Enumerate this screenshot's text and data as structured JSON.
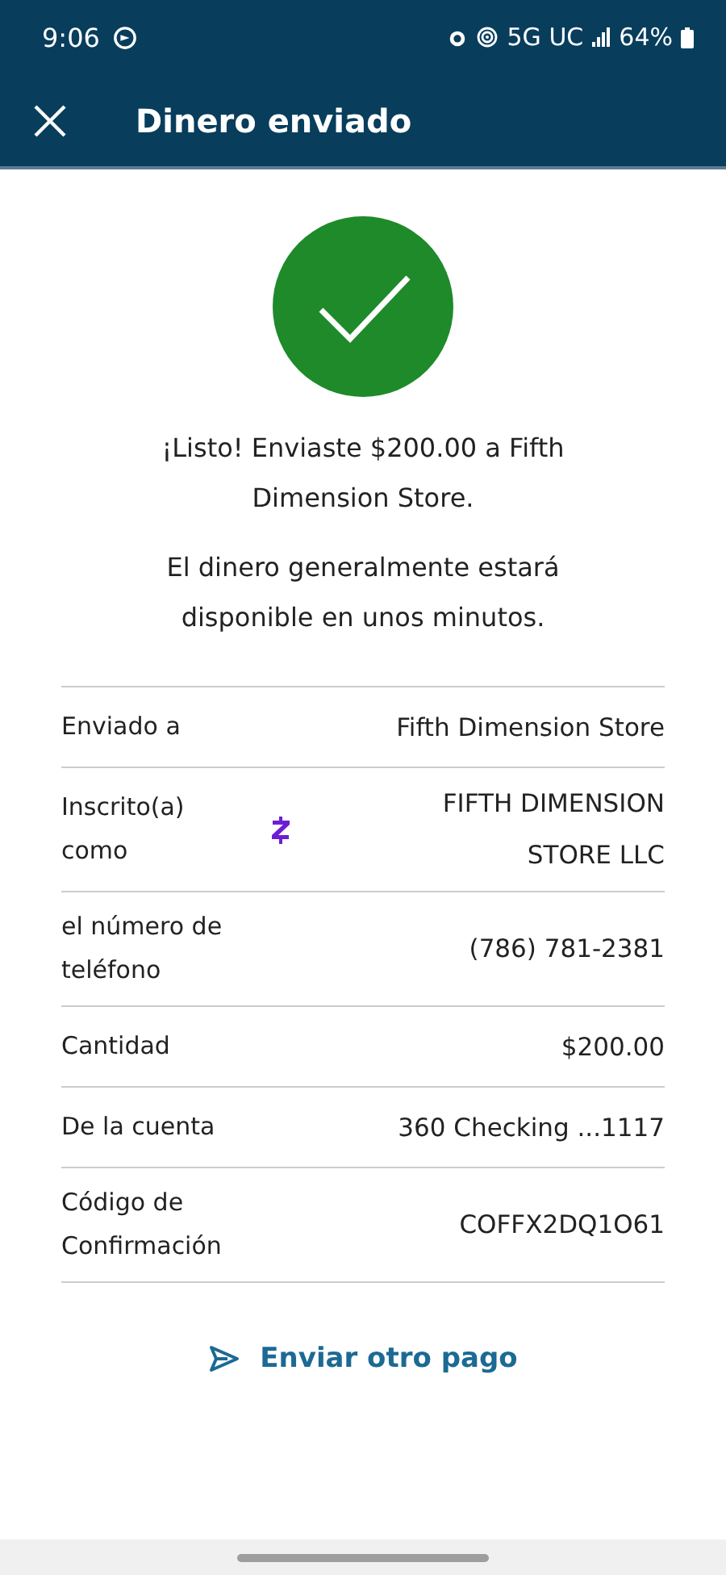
{
  "status_bar": {
    "time": "9:06",
    "network": "5G UC",
    "battery": "64%"
  },
  "header": {
    "title": "Dinero enviado"
  },
  "message": "¡Listo! Enviaste $200.00 a Fifth Dimension Store.",
  "note": "El dinero generalmente estará disponible en unos minutos.",
  "details": [
    {
      "kind": "plain",
      "label": "Enviado a",
      "value": "Fifth Dimension Store"
    },
    {
      "kind": "zelle",
      "label": "Inscrito(a) como",
      "value": "FIFTH DIMENSION STORE LLC"
    },
    {
      "kind": "plain",
      "label": "el número de teléfono",
      "value": "(786) 781-2381"
    },
    {
      "kind": "plain",
      "label": "Cantidad",
      "value": "$200.00"
    },
    {
      "kind": "plain",
      "label": "De la cuenta",
      "value": "360 Checking ...1117"
    },
    {
      "kind": "plain",
      "label": "Código de Confirmación",
      "value": "COFFX2DQ1O61"
    }
  ],
  "action": {
    "label": "Enviar otro pago"
  }
}
